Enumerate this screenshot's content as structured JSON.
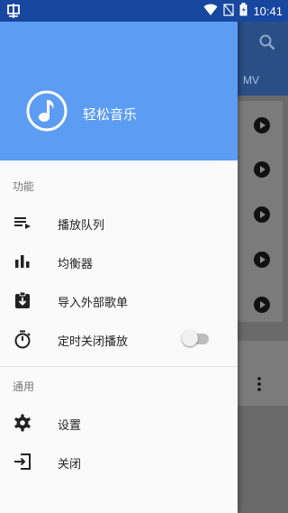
{
  "status_bar": {
    "time": "10:41",
    "icons": [
      "app-notification-icon",
      "wifi-icon",
      "no-sim-icon",
      "battery-icon"
    ]
  },
  "background": {
    "tab_label": "MV"
  },
  "drawer": {
    "app_name": "轻松音乐",
    "section_function": "功能",
    "items_function": [
      {
        "label": "播放队列",
        "icon": "queue-icon"
      },
      {
        "label": "均衡器",
        "icon": "equalizer-icon"
      },
      {
        "label": "导入外部歌单",
        "icon": "import-playlist-icon"
      },
      {
        "label": "定时关闭播放",
        "icon": "timer-icon"
      }
    ],
    "timer_toggle_on": false,
    "section_general": "通用",
    "items_general": [
      {
        "label": "设置",
        "icon": "gear-icon"
      },
      {
        "label": "关闭",
        "icon": "exit-icon"
      }
    ]
  },
  "colors": {
    "header": "#5c9cf3",
    "statusbar": "#17479e"
  }
}
